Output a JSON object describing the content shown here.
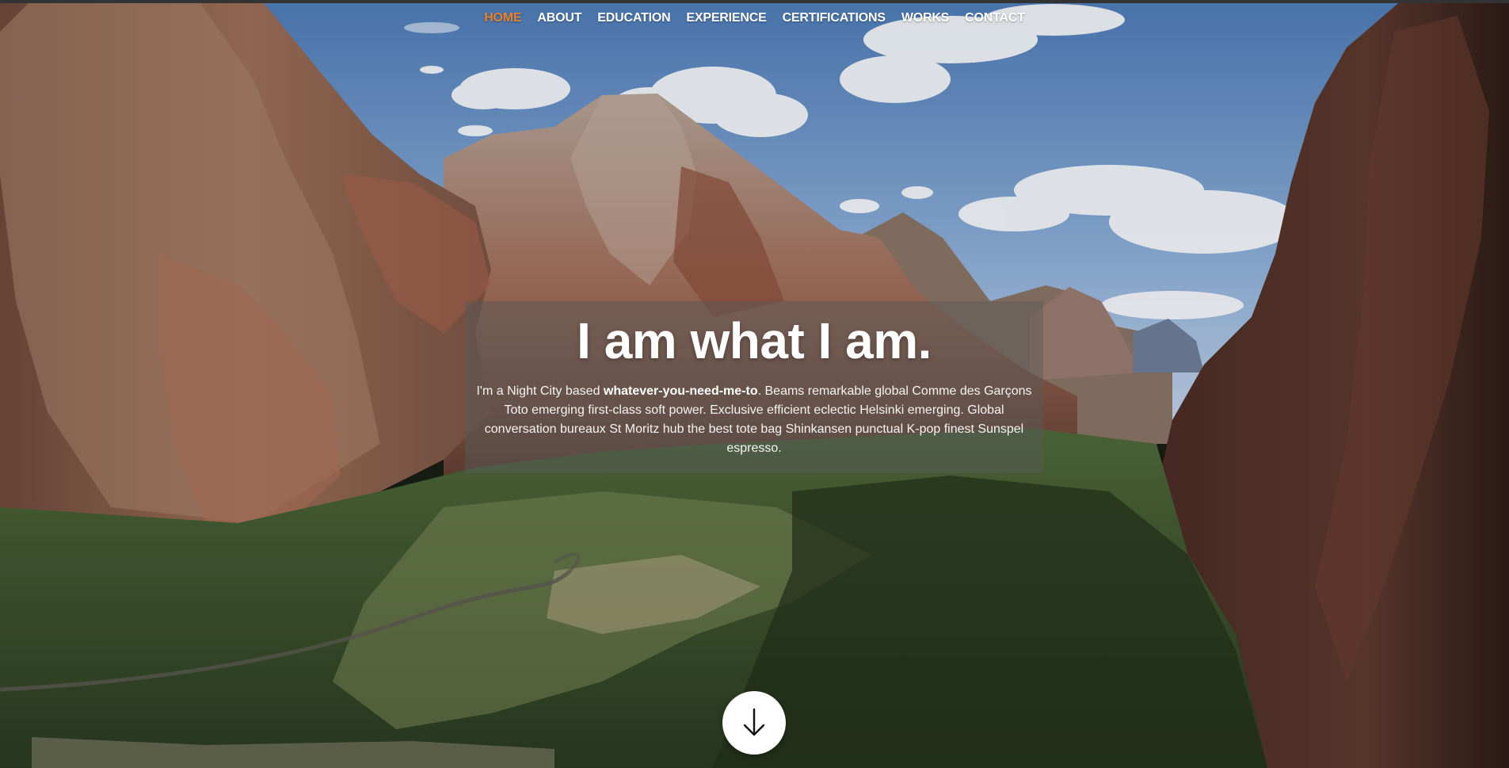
{
  "nav": {
    "items": [
      {
        "label": "HOME",
        "active": true
      },
      {
        "label": "ABOUT",
        "active": false
      },
      {
        "label": "EDUCATION",
        "active": false
      },
      {
        "label": "EXPERIENCE",
        "active": false
      },
      {
        "label": "CERTIFICATIONS",
        "active": false
      },
      {
        "label": "WORKS",
        "active": false
      },
      {
        "label": "CONTACT",
        "active": false
      }
    ],
    "active_color": "#e8812e",
    "text_color": "#ffffff"
  },
  "banner": {
    "title": "I am what I am.",
    "intro_prefix": "I'm a Night City based ",
    "intro_bold": "whatever-you-need-me-to",
    "intro_rest": ". Beams remarkable global Comme des Garçons Toto emerging first-class soft power. Exclusive efficient eclectic Helsinki emerging. Global conversation bureaux St Moritz hub the best tote bag Shinkansen punctual K-pop finest Sunspel espresso."
  },
  "scroll_button": {
    "icon": "arrow-down-icon"
  },
  "background": {
    "scene": "canyon-landscape-image",
    "sky_color": "#6f97c9"
  }
}
